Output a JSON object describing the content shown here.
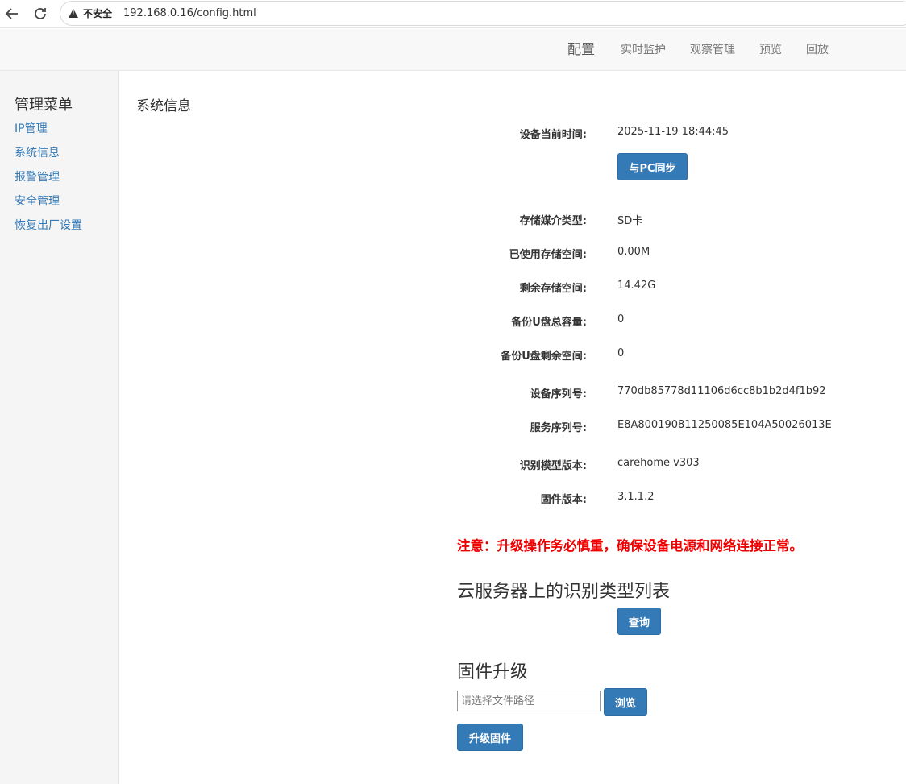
{
  "browser": {
    "insecure_label": "不安全",
    "url": "192.168.0.16/config.html"
  },
  "navbar": {
    "items": [
      "配置",
      "实时监护",
      "观察管理",
      "预览",
      "回放"
    ]
  },
  "sidebar": {
    "title": "管理菜单",
    "items": [
      "IP管理",
      "系统信息",
      "报警管理",
      "安全管理",
      "恢复出厂设置"
    ]
  },
  "main": {
    "section_title": "系统信息",
    "rows": [
      {
        "label": "设备当前时间:",
        "value": "2025-11-19 18:44:45"
      },
      {
        "label": "存储媒介类型:",
        "value": "SD卡"
      },
      {
        "label": "已使用存储空间:",
        "value": "0.00M"
      },
      {
        "label": "剩余存储空间:",
        "value": "14.42G"
      },
      {
        "label": "备份U盘总容量:",
        "value": "0"
      },
      {
        "label": "备份U盘剩余空间:",
        "value": "0"
      },
      {
        "label": "设备序列号:",
        "value": "770db85778d11106d6cc8b1b2d4f1b92"
      },
      {
        "label": "服务序列号:",
        "value": "E8A800190811250085E104A50026013E"
      },
      {
        "label": "识别模型版本:",
        "value": "carehome v303"
      },
      {
        "label": "固件版本:",
        "value": "3.1.1.2"
      }
    ],
    "sync_button": "与PC同步",
    "warning": "注意：升级操作务必慎重，确保设备电源和网络连接正常。",
    "cloud_heading": "云服务器上的识别类型列表",
    "query_button": "查询",
    "firmware_heading": "固件升级",
    "file_placeholder": "请选择文件路径",
    "browse_button": "浏览",
    "upgrade_button": "升级固件"
  }
}
